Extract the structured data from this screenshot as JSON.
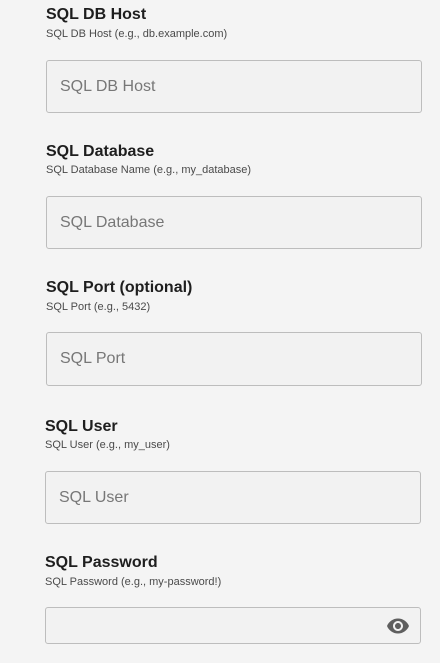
{
  "fields": [
    {
      "label": "SQL DB Host",
      "hint": "SQL DB Host (e.g., db.example.com)",
      "placeholder": "SQL DB Host",
      "value": ""
    },
    {
      "label": "SQL Database",
      "hint": "SQL Database Name (e.g., my_database)",
      "placeholder": "SQL Database",
      "value": ""
    },
    {
      "label": "SQL Port (optional)",
      "hint": "SQL Port (e.g., 5432)",
      "placeholder": "SQL Port",
      "value": ""
    },
    {
      "label": "SQL User",
      "hint": "SQL User (e.g., my_user)",
      "placeholder": "SQL User",
      "value": ""
    },
    {
      "label": "SQL Password",
      "hint": "SQL Password (e.g., my-password!)",
      "placeholder": "",
      "value": "",
      "toggle_icon": "eye-icon"
    }
  ],
  "colors": {
    "background": "#f4f4f4",
    "input_border": "#bdbdbd",
    "icon": "#5f5f5f"
  }
}
